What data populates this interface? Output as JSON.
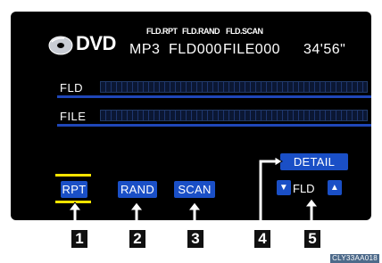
{
  "header": {
    "source_label": "DVD",
    "disc_icon": "disc-icon",
    "flag_rpt": "FLD.RPT",
    "flag_rand": "FLD.RAND",
    "flag_scan": "FLD.SCAN",
    "format": "MP3",
    "folder": "FLD000",
    "file": "FILE000",
    "time": "34'56\""
  },
  "rows": {
    "folder_label": "FLD",
    "file_label": "FILE"
  },
  "buttons": {
    "rpt": "RPT",
    "rand": "RAND",
    "scan": "SCAN",
    "detail": "DETAIL",
    "folder_label": "FLD",
    "folder_down_icon": "triangle-down-icon",
    "folder_up_icon": "triangle-up-icon"
  },
  "callouts": [
    "1",
    "2",
    "3",
    "4",
    "5"
  ],
  "image_code": "CLY33AA018",
  "colors": {
    "screen_bg": "#000000",
    "button_blue": "#1a4fc6",
    "active_highlight": "#ffe400",
    "separator": "#1f46b8"
  }
}
